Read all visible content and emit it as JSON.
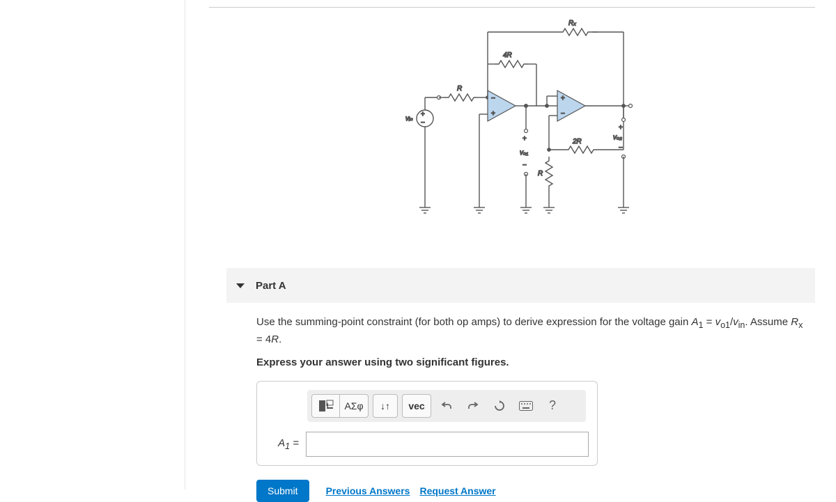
{
  "part": {
    "label": "Part A"
  },
  "question": {
    "prefix": "Use the summing-point constraint (for both op amps) to derive expression for the voltage gain ",
    "gain_symbol": "A",
    "gain_sub": "1",
    "equals": " = ",
    "vo_sym": "v",
    "vo_sub": "o1",
    "slash": "/",
    "vin_sym": "v",
    "vin_sub": "in",
    "suffix": ". Assume ",
    "rx_sym": "R",
    "rx_sub": "x",
    "rx_eq": " = 4",
    "r_sym": "R",
    "period": "."
  },
  "express_line": "Express your answer using two significant figures.",
  "toolbar": {
    "templates_label": "▢",
    "math_label": "ΑΣφ",
    "subsuper_label": "↓↑",
    "vec_label": "vec"
  },
  "answer": {
    "label_A": "A",
    "label_sub": "1",
    "label_eq": " =",
    "value": ""
  },
  "buttons": {
    "submit": "Submit",
    "prev": "Previous Answers",
    "request": "Request Answer"
  },
  "circuit": {
    "Rx": "Rₓ",
    "R4": "4R",
    "R": "R",
    "R2": "2R",
    "Rvert": "R",
    "Vin": "vᵢₙ",
    "Vo1": "vₒ₁",
    "Vo2": "vₒ₂",
    "plus": "+",
    "minus": "−"
  }
}
